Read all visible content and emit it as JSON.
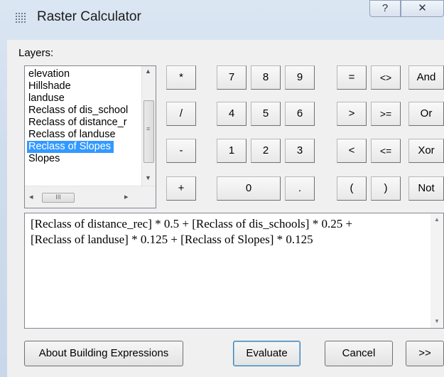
{
  "window": {
    "title": "Raster Calculator",
    "help_label": "?",
    "close_label": "✕"
  },
  "layers": {
    "label": "Layers:",
    "items": [
      {
        "label": "elevation",
        "selected": false
      },
      {
        "label": "Hillshade",
        "selected": false
      },
      {
        "label": "landuse",
        "selected": false
      },
      {
        "label": "Reclass of dis_school",
        "selected": false
      },
      {
        "label": "Reclass of distance_r",
        "selected": false
      },
      {
        "label": "Reclass of landuse",
        "selected": false
      },
      {
        "label": "Reclass of Slopes",
        "selected": true
      },
      {
        "label": "Slopes",
        "selected": false
      }
    ],
    "hscroll_thumb": "III"
  },
  "calculator": {
    "buttons": [
      [
        "*",
        "7",
        "8",
        "9",
        "=",
        "<>",
        "And"
      ],
      [
        "/",
        "4",
        "5",
        "6",
        ">",
        ">=",
        "Or"
      ],
      [
        "-",
        "1",
        "2",
        "3",
        "<",
        "<=",
        "Xor"
      ],
      [
        "+",
        "0",
        ".",
        "(",
        ")",
        "Not"
      ]
    ]
  },
  "expression": {
    "text": "[Reclass of distance_rec] * 0.5 + [Reclass of dis_schools] * 0.25 +\n[Reclass of landuse] * 0.125 + [Reclass of Slopes] * 0.125"
  },
  "footer": {
    "about_label": "About Building Expressions",
    "evaluate_label": "Evaluate",
    "cancel_label": "Cancel",
    "more_label": ">>"
  },
  "colors": {
    "selection": "#3399ff",
    "title_gradient": "#cfdced"
  }
}
